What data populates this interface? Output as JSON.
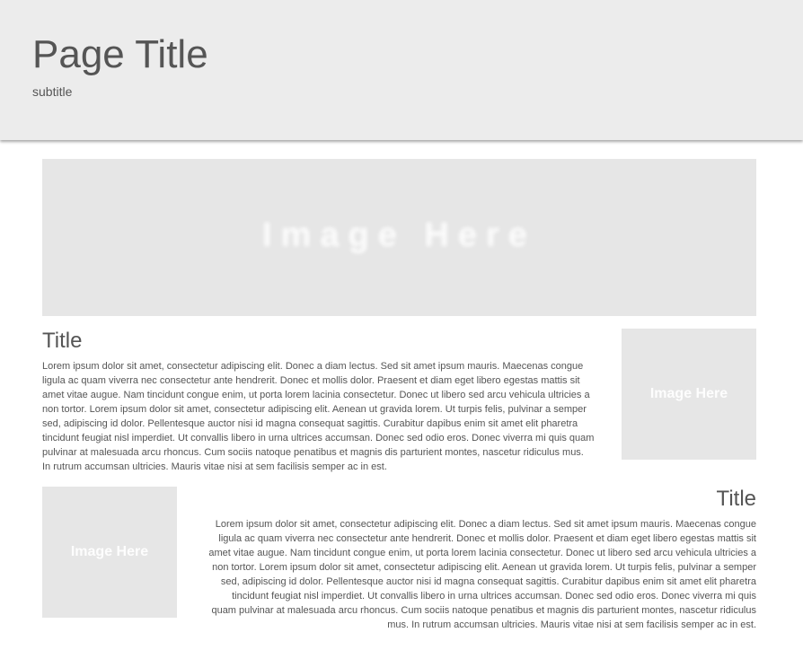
{
  "header": {
    "title": "Page Title",
    "subtitle": "subtitle"
  },
  "hero": {
    "placeholder": "Image Here"
  },
  "section1": {
    "title": "Title",
    "image_placeholder": "Image Here",
    "body": "Lorem ipsum dolor sit amet, consectetur adipiscing elit. Donec a diam lectus. Sed sit amet ipsum mauris. Maecenas congue ligula ac quam viverra nec consectetur ante hendrerit. Donec et mollis dolor. Praesent et diam eget libero egestas mattis sit amet vitae augue. Nam tincidunt congue enim, ut porta lorem lacinia consectetur. Donec ut libero sed arcu vehicula ultricies a non tortor. Lorem ipsum dolor sit amet, consectetur adipiscing elit. Aenean ut gravida lorem. Ut turpis felis, pulvinar a semper sed, adipiscing id dolor. Pellentesque auctor nisi id magna consequat sagittis. Curabitur dapibus enim sit amet elit pharetra tincidunt feugiat nisl imperdiet. Ut convallis libero in urna ultrices accumsan. Donec sed odio eros. Donec viverra mi quis quam pulvinar at malesuada arcu rhoncus. Cum sociis natoque penatibus et magnis dis parturient montes, nascetur ridiculus mus. In rutrum accumsan ultricies. Mauris vitae nisi at sem facilisis semper ac in est."
  },
  "section2": {
    "title": "Title",
    "image_placeholder": "Image Here",
    "body": "Lorem ipsum dolor sit amet, consectetur adipiscing elit. Donec a diam lectus. Sed sit amet ipsum mauris. Maecenas congue ligula ac quam viverra nec consectetur ante hendrerit. Donec et mollis dolor. Praesent et diam eget libero egestas mattis sit amet vitae augue. Nam tincidunt congue enim, ut porta lorem lacinia consectetur. Donec ut libero sed arcu vehicula ultricies a non tortor. Lorem ipsum dolor sit amet, consectetur adipiscing elit. Aenean ut gravida lorem. Ut turpis felis, pulvinar a semper sed, adipiscing id dolor. Pellentesque auctor nisi id magna consequat sagittis. Curabitur dapibus enim sit amet elit pharetra tincidunt feugiat nisl imperdiet. Ut convallis libero in urna ultrices accumsan. Donec sed odio eros. Donec viverra mi quis quam pulvinar at malesuada arcu rhoncus. Cum sociis natoque penatibus et magnis dis parturient montes, nascetur ridiculus mus. In rutrum accumsan ultricies. Mauris vitae nisi at sem facilisis semper ac in est."
  },
  "colors": {
    "header_bg": "#ececec",
    "placeholder_bg": "#e6e6e6",
    "text": "#555555"
  }
}
